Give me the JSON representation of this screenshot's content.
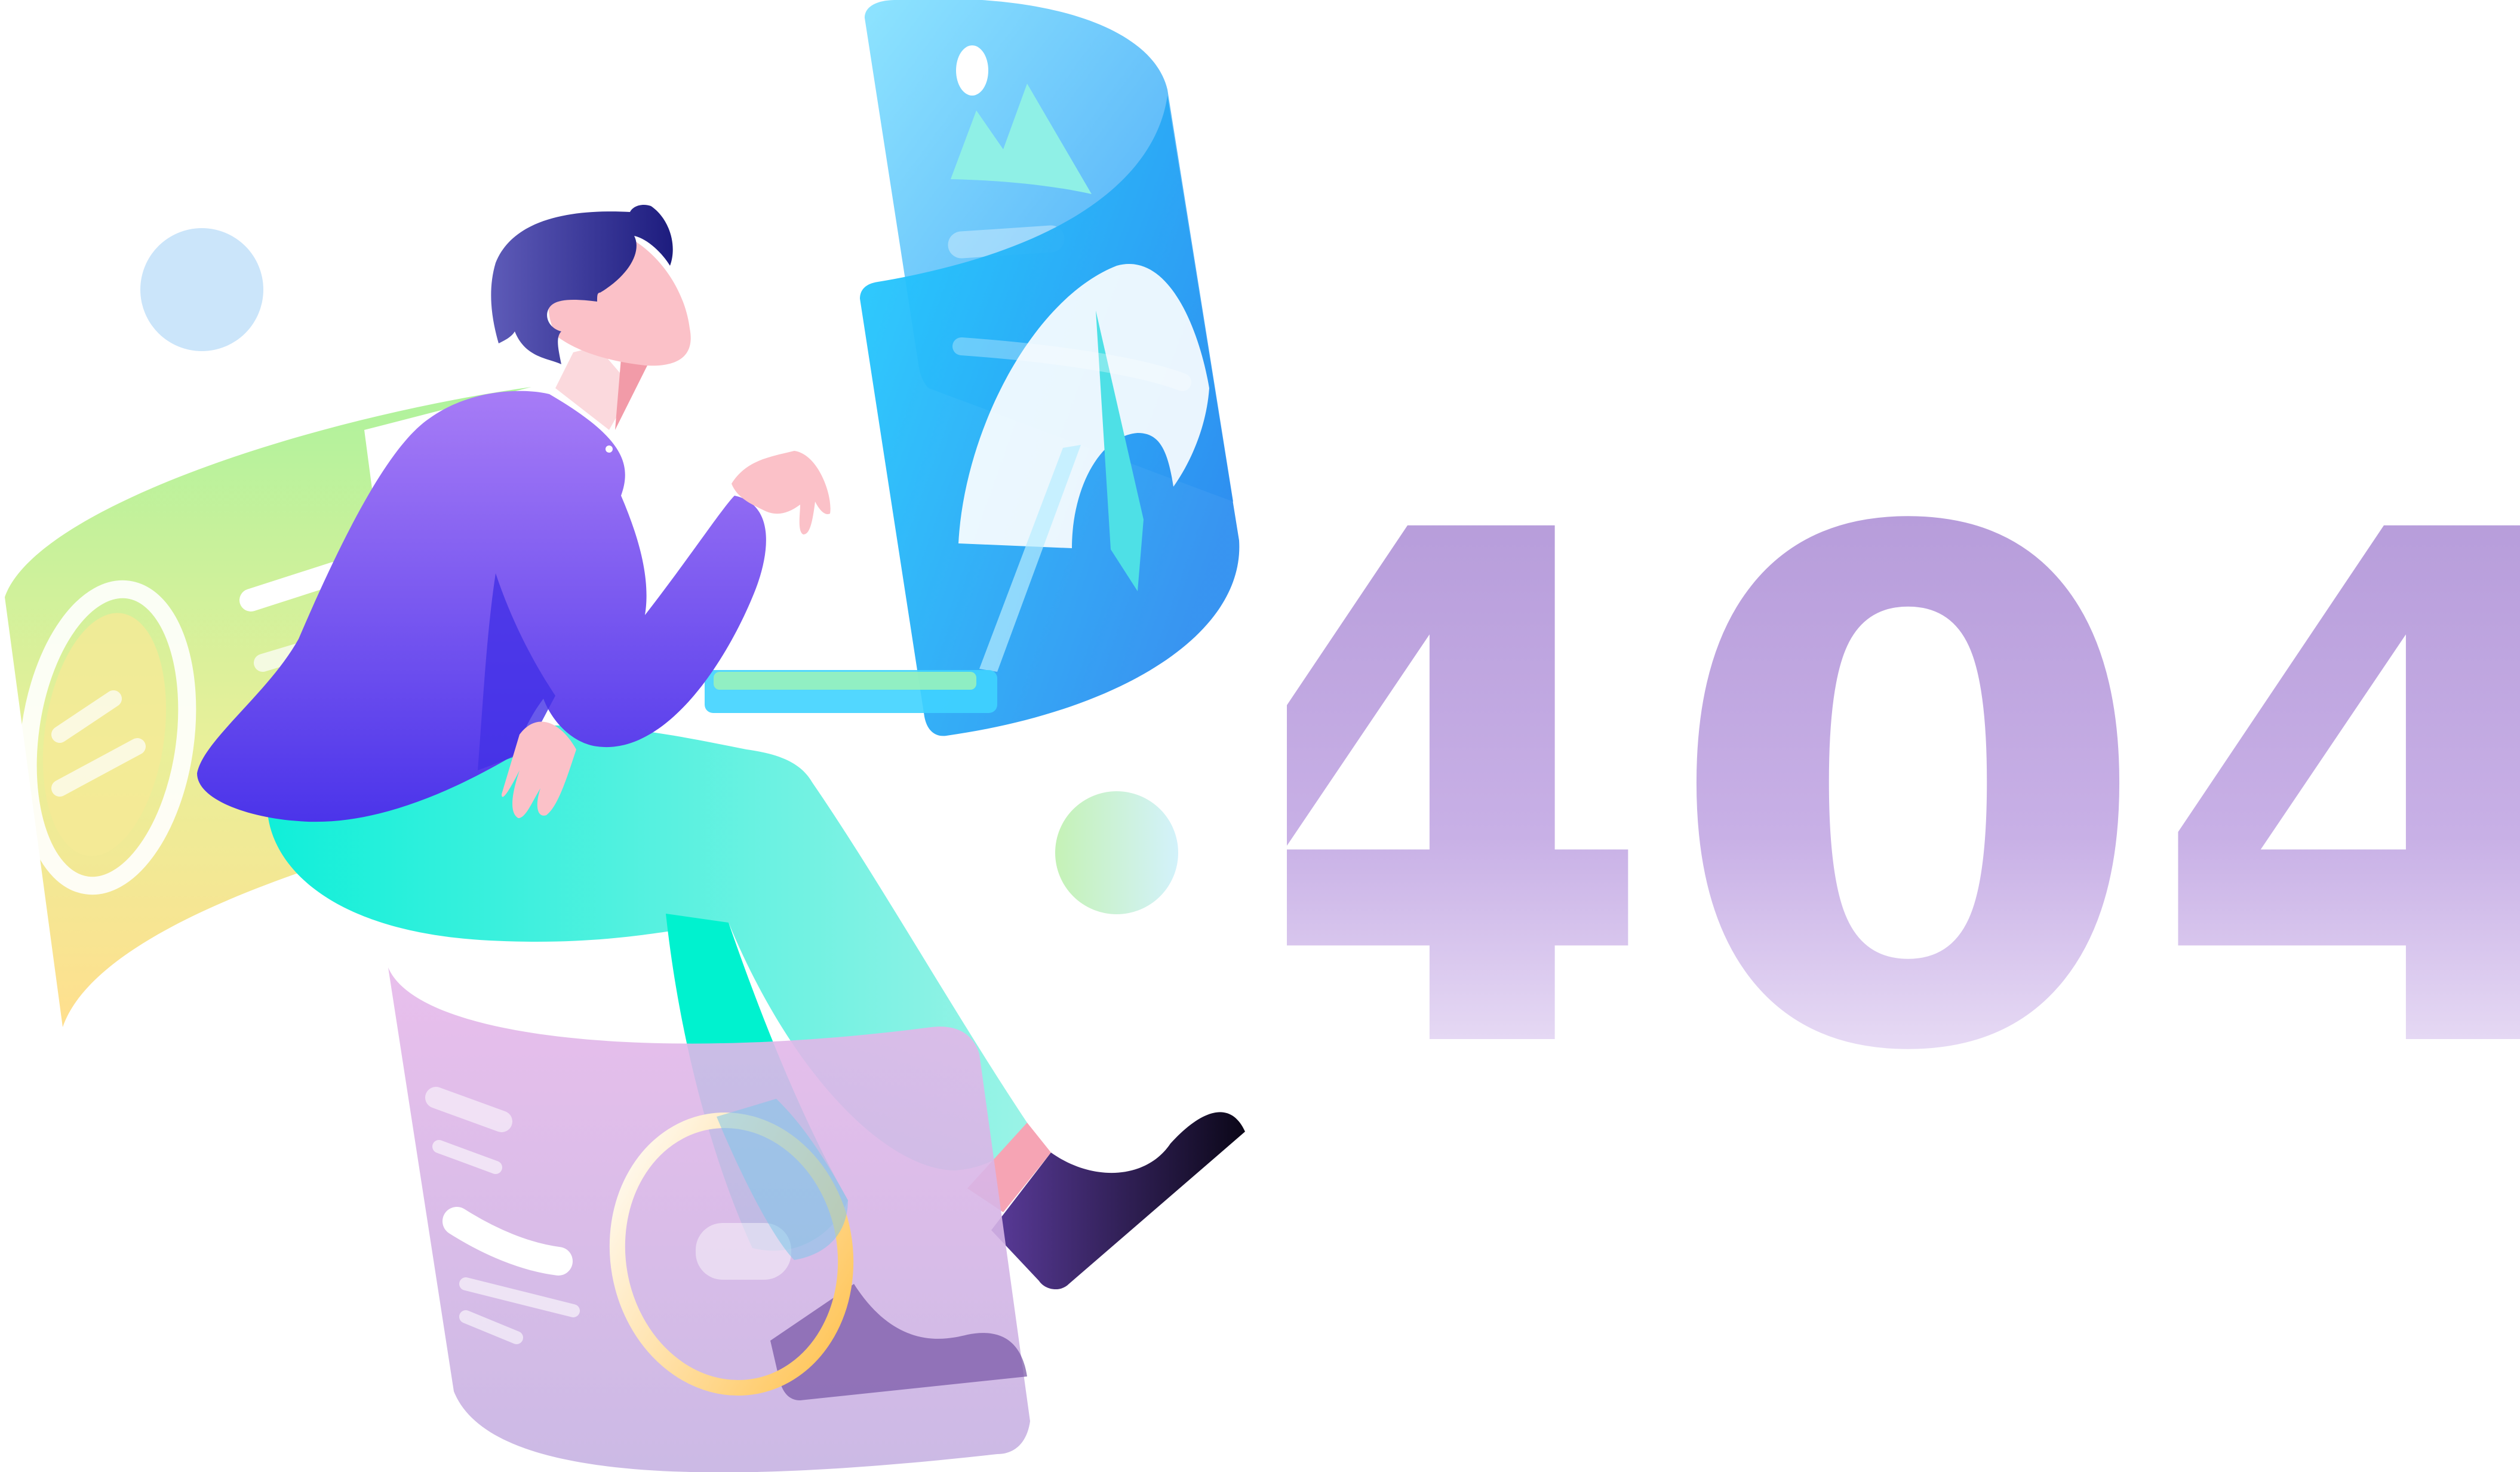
{
  "error_page": {
    "code_digits": [
      "4",
      "0",
      "4"
    ],
    "illustration": "person-at-floating-screens",
    "colors": {
      "digit_top": "#b18fd6",
      "digit_bottom": "#ffffff",
      "screen_blue": "#2aa8ff",
      "screen_cyan": "#5ad8ff",
      "panel_green": "#a8ef9a",
      "panel_yellow": "#ffe08a",
      "panel_purple": "#d9b2ea",
      "shirt_purple": "#7c55f0",
      "pants_teal": "#19f0d0",
      "skin": "#fbc1c8",
      "hair": "#2c2a8a",
      "dot_blue": "#cbe5fa"
    }
  }
}
